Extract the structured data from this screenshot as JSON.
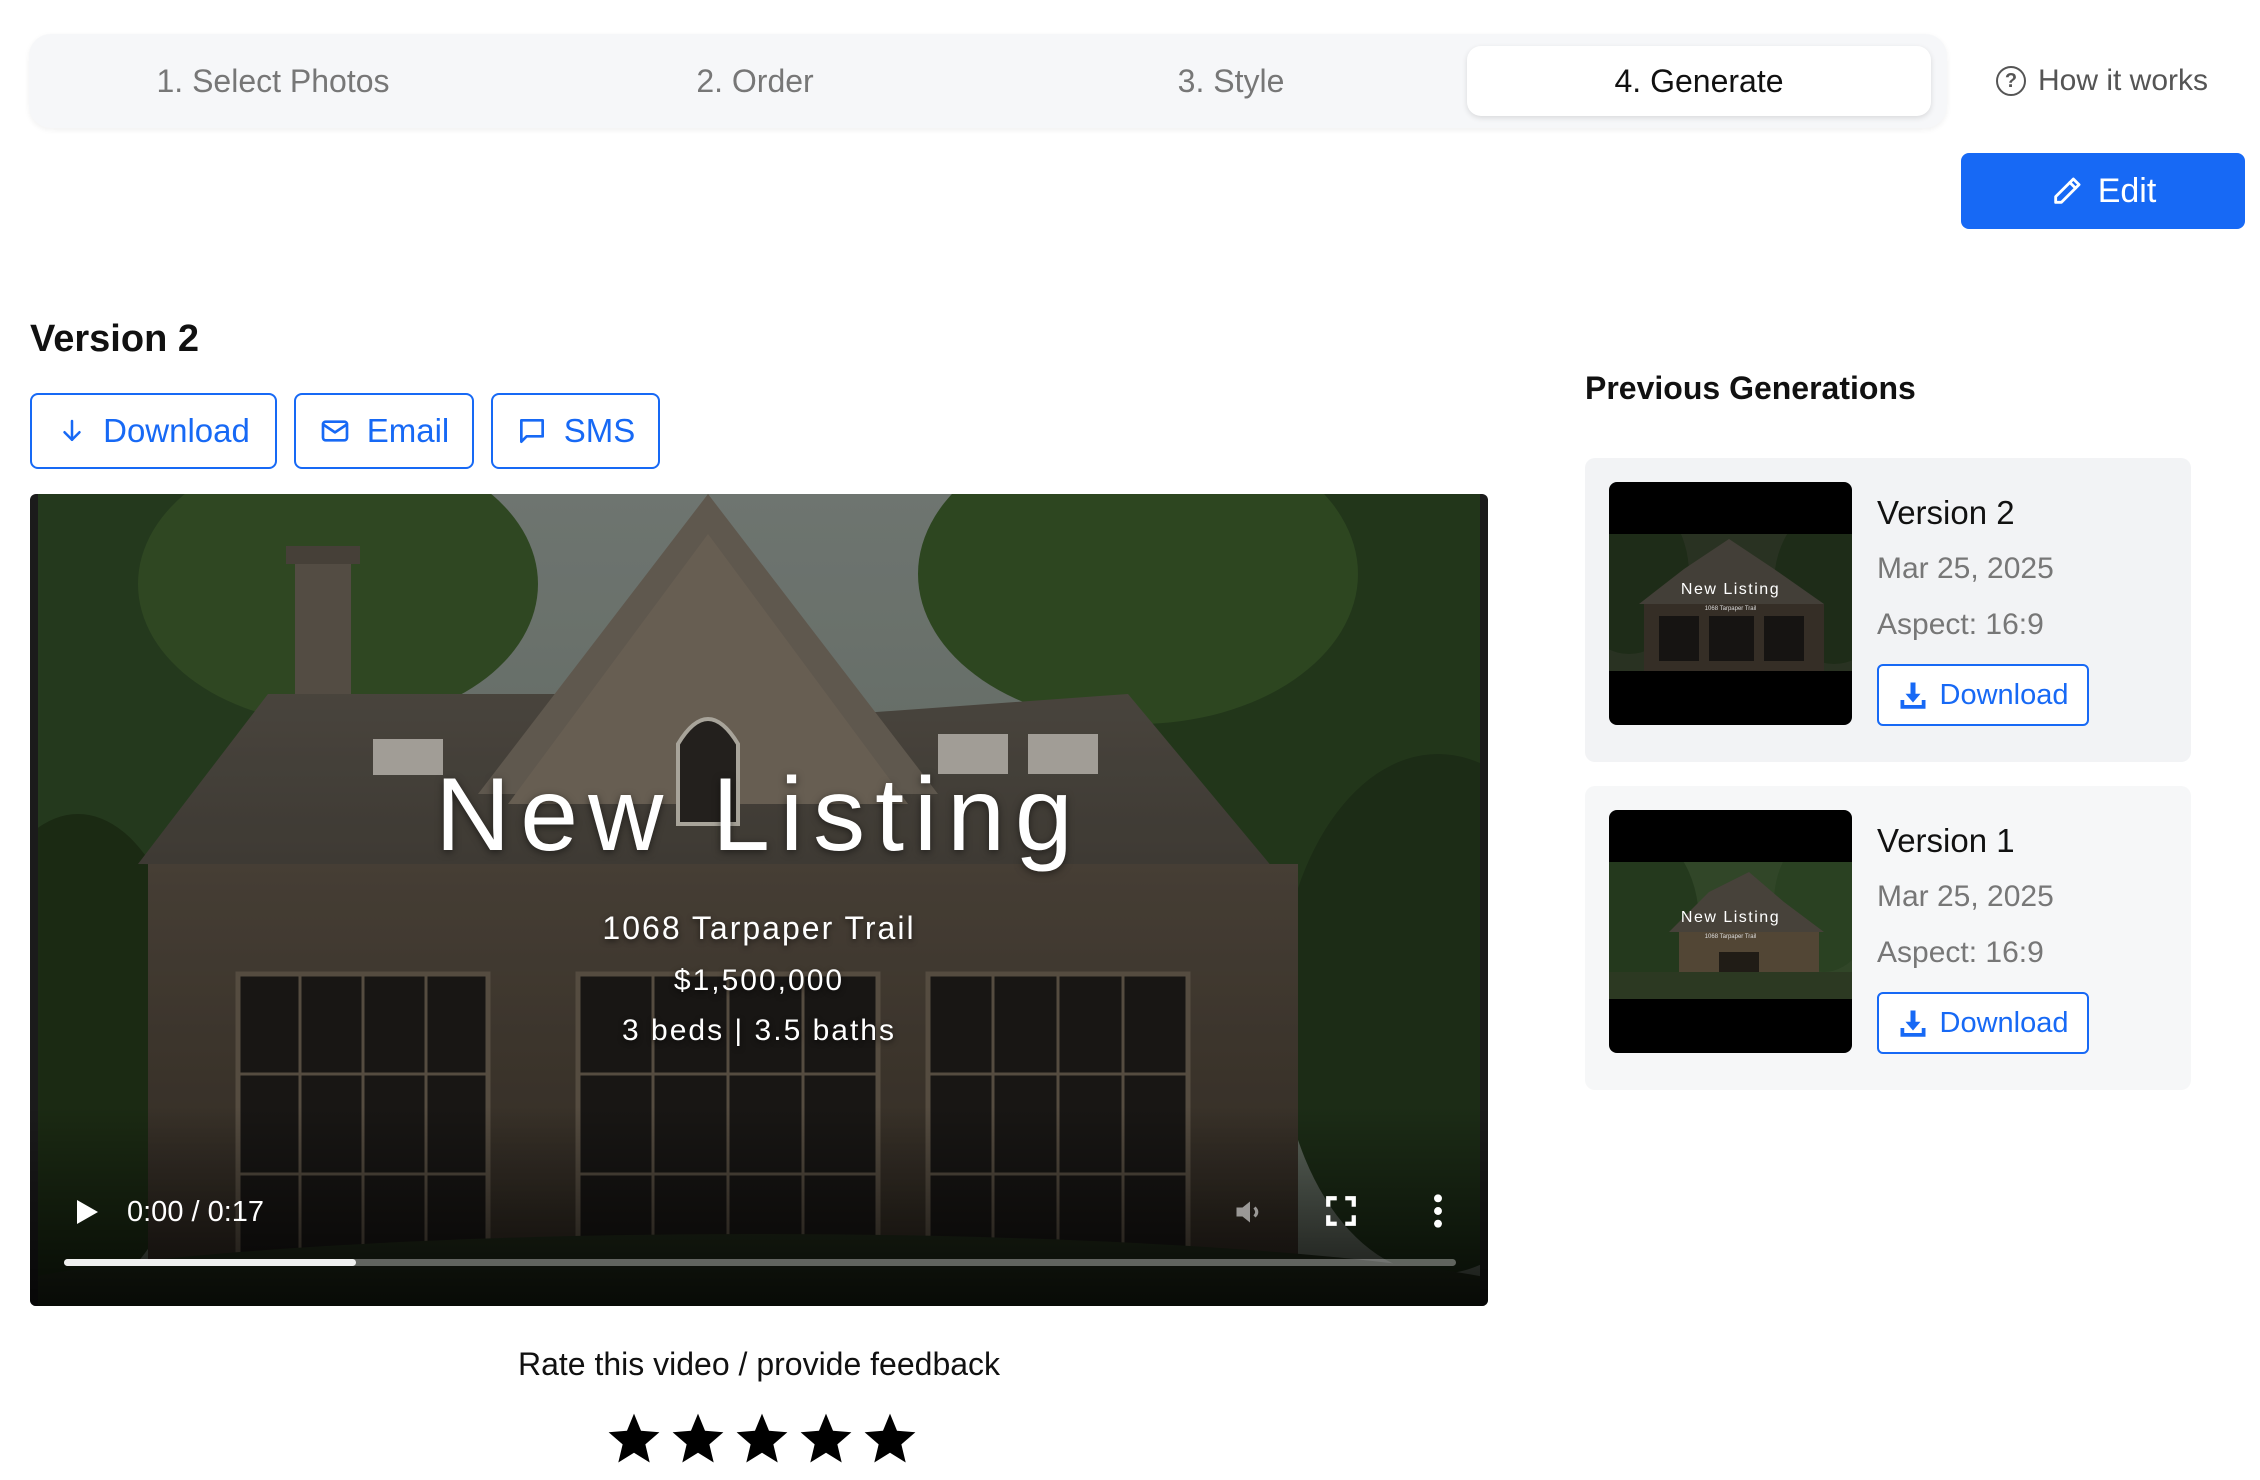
{
  "stepper": {
    "steps": [
      "1. Select Photos",
      "2. Order",
      "3. Style"
    ],
    "active_step": "4. Generate",
    "how_it_works": "How it works"
  },
  "toolbar": {
    "edit_label": "Edit"
  },
  "version": {
    "title": "Version 2",
    "actions": {
      "download": "Download",
      "email": "Email",
      "sms": "SMS"
    }
  },
  "video": {
    "overlay_title": "New Listing",
    "address": "1068 Tarpaper Trail",
    "price": "$1,500,000",
    "beds_baths": "3 beds | 3.5 baths",
    "time": "0:00 / 0:17",
    "buffered_fraction": 0.21
  },
  "feedback": {
    "prompt": "Rate this video / provide feedback",
    "star_count": 5
  },
  "previous": {
    "title": "Previous Generations",
    "items": [
      {
        "name": "Version 2",
        "date": "Mar 25, 2025",
        "aspect": "Aspect: 16:9",
        "download": "Download",
        "thumb_title": "New Listing",
        "thumb_sub": "1068 Tarpaper Trail"
      },
      {
        "name": "Version 1",
        "date": "Mar 25, 2025",
        "aspect": "Aspect: 16:9",
        "download": "Download",
        "thumb_title": "New Listing",
        "thumb_sub": "1068 Tarpaper Trail"
      }
    ]
  },
  "colors": {
    "accent": "#1769f5",
    "muted": "#777777"
  }
}
